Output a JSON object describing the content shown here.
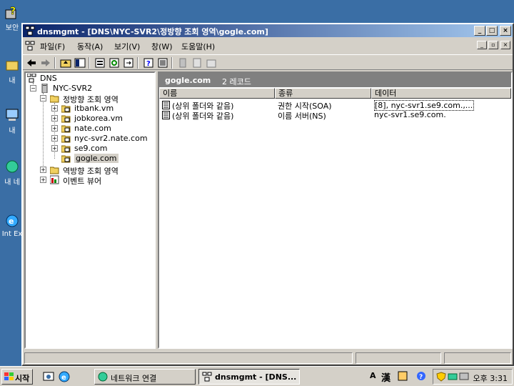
{
  "window": {
    "title": "dnsmgmt - [DNS\\NYC-SVR2\\정방향 조회 영역\\gogle.com]",
    "min": "_",
    "max": "□",
    "close": "×"
  },
  "menu": {
    "file": "파일(F)",
    "action": "동작(A)",
    "view": "보기(V)",
    "window": "창(W)",
    "help": "도움말(H)"
  },
  "tree": {
    "root": "DNS",
    "server": "NYC-SVR2",
    "forward": "정방향 조회 영역",
    "zones": [
      "itbank.vm",
      "jobkorea.vm",
      "nate.com",
      "nyc-svr2.nate.com",
      "se9.com",
      "gogle.com"
    ],
    "reverse": "역방향 조회 영역",
    "events": "이벤트 뷰어"
  },
  "result": {
    "title": "gogle.com",
    "count": "2 레코드",
    "columns": [
      "이름",
      "종류",
      "데이터"
    ],
    "rows": [
      [
        "(상위 폴더와 같음)",
        "권한 시작(SOA)",
        "[8], nyc-svr1.se9.com.,..."
      ],
      [
        "(상위 폴더와 같음)",
        "이름 서버(NS)",
        "nyc-svr1.se9.com."
      ]
    ]
  },
  "taskbar": {
    "start": "시작",
    "buttons": [
      "네트워크 연결",
      "dnsmgmt - [DNS..."
    ],
    "clock": "오후 3:31",
    "ime_mode": "A",
    "ime_hanja": "漢"
  },
  "desktop": {
    "icons": [
      "보안",
      "내",
      "내",
      "내 네",
      "Int Ex"
    ]
  }
}
